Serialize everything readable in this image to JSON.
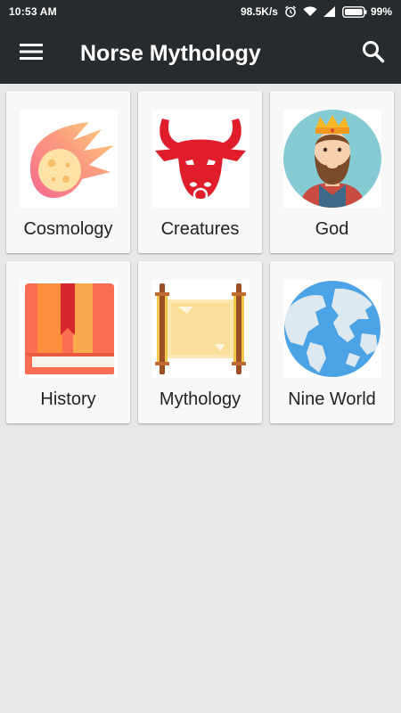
{
  "status_bar": {
    "time": "10:53 AM",
    "speed": "98.5K/s",
    "battery": "99%"
  },
  "app_bar": {
    "title": "Norse Mythology",
    "menu_icon": "hamburger-menu-icon",
    "search_icon": "search-icon"
  },
  "categories": [
    {
      "label": "Cosmology",
      "icon": "comet-icon"
    },
    {
      "label": "Creatures",
      "icon": "bull-head-icon"
    },
    {
      "label": "God",
      "icon": "crowned-king-icon"
    },
    {
      "label": "History",
      "icon": "book-icon"
    },
    {
      "label": "Mythology",
      "icon": "scroll-icon"
    },
    {
      "label": "Nine World",
      "icon": "globe-icon"
    }
  ],
  "colors": {
    "app_bar": "#272b2e",
    "background": "#e8e8e8",
    "tile": "#f8f8f8"
  }
}
